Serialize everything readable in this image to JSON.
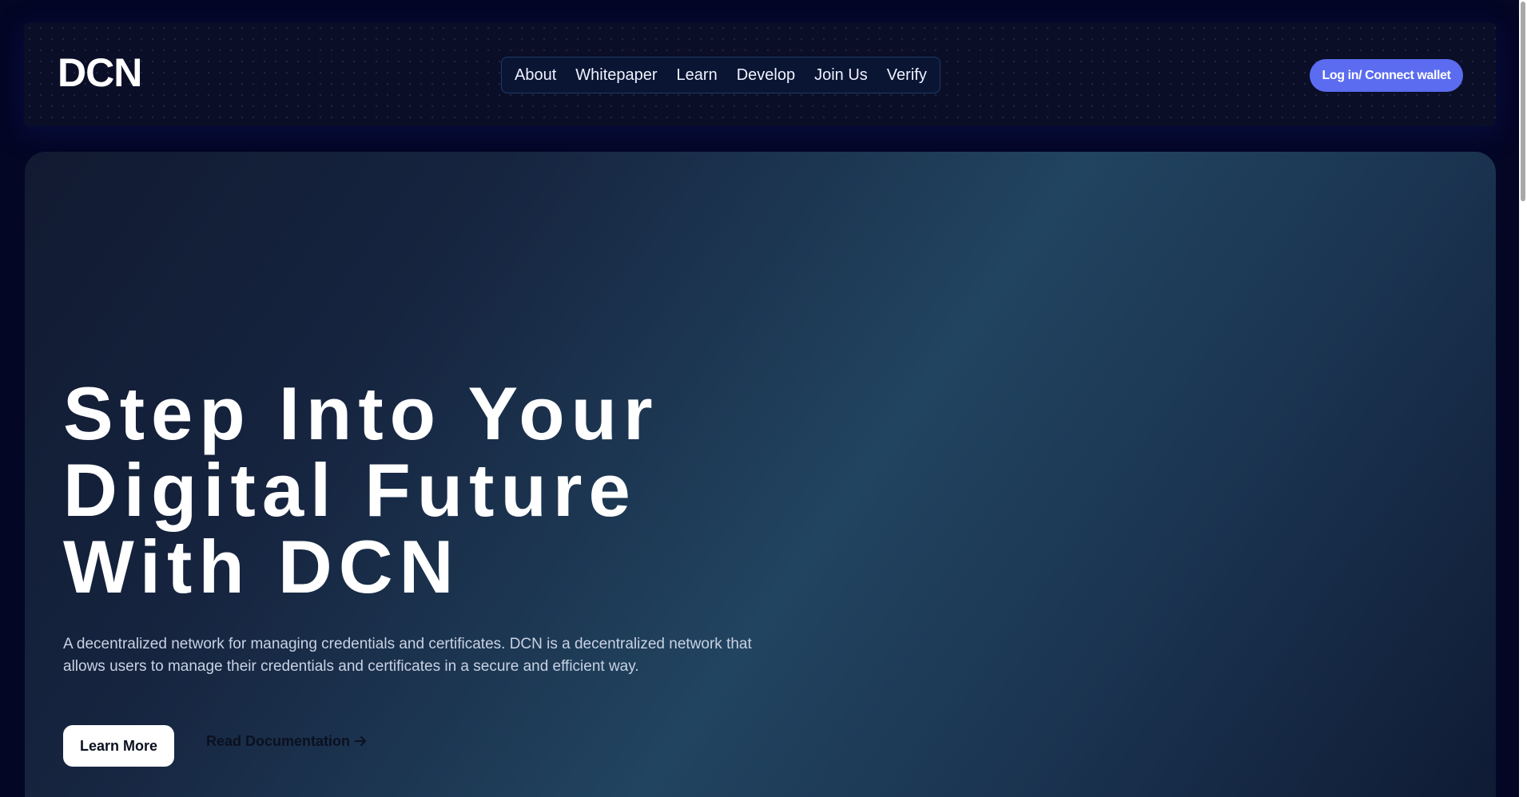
{
  "header": {
    "logo": "DCN",
    "nav": [
      "About",
      "Whitepaper",
      "Learn",
      "Develop",
      "Join Us",
      "Verify"
    ],
    "connect_label": "Log in/ Connect wallet"
  },
  "hero": {
    "title_lines": [
      "Step Into Your",
      "Digital Future",
      "With DCN"
    ],
    "description": "A decentralized network for managing credentials and certificates. DCN is a decentralized network that allows users to manage their credentials and certificates in a secure and efficient way.",
    "learn_more_label": "Learn More",
    "docs_label": "Read Documentation",
    "docs_icon": "arrow-right-icon"
  },
  "colors": {
    "background": "#040626",
    "accent": "#5b6cf0",
    "hero_gradient_mid": "#214460"
  }
}
